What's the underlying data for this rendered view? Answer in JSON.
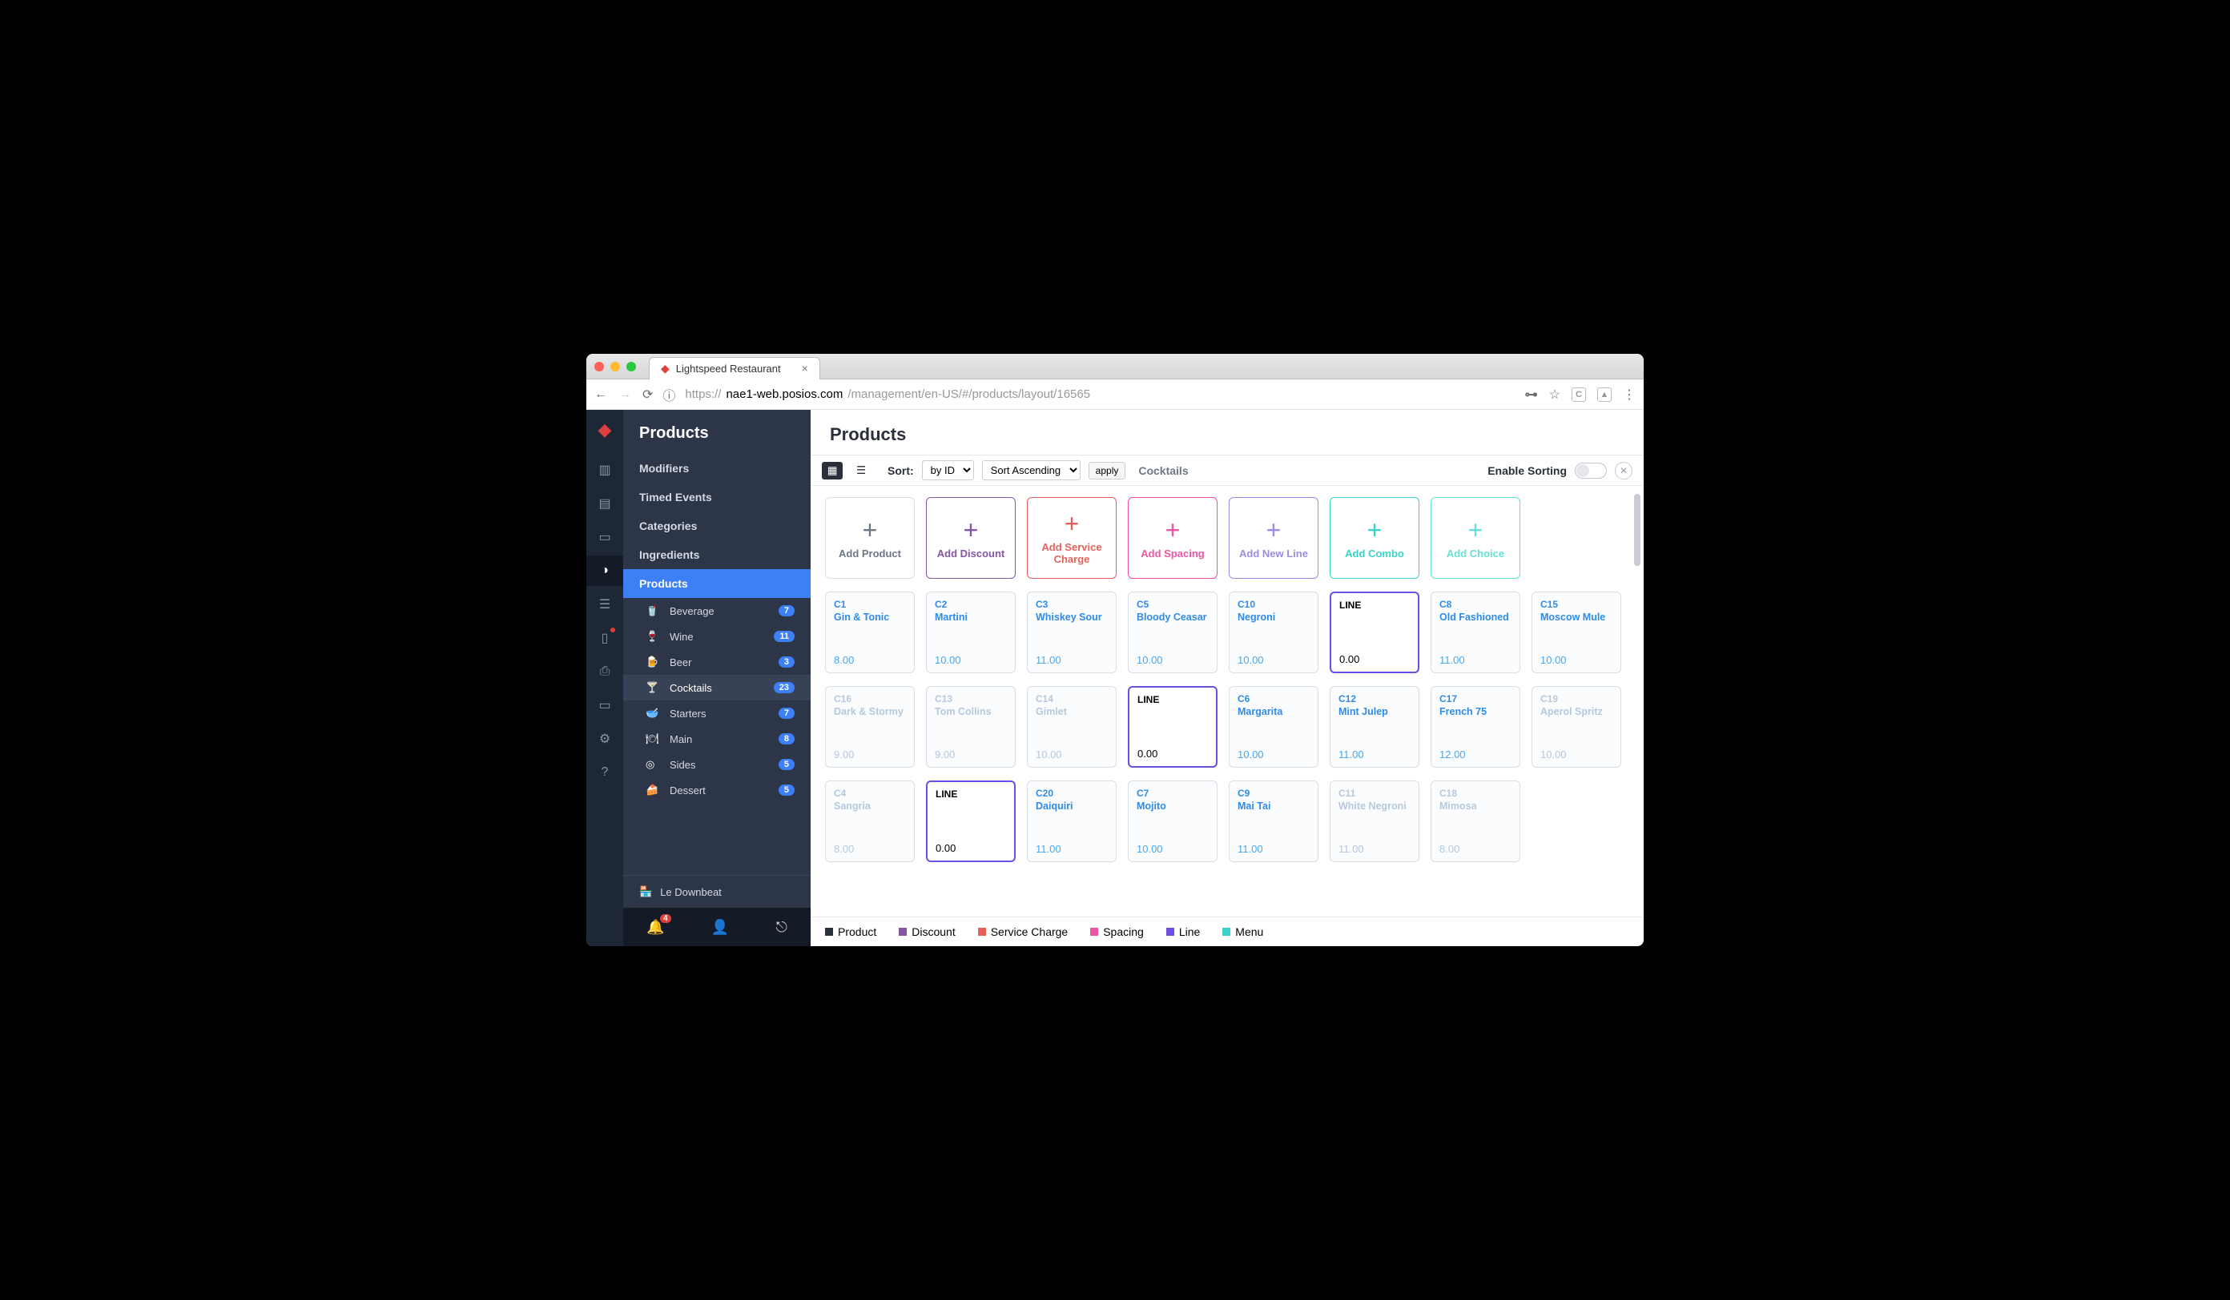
{
  "browser": {
    "tab_title": "Lightspeed Restaurant",
    "url_proto": "https://",
    "url_host": "nae1-web.posios.com",
    "url_path": "/management/en-US/#/products/layout/16565"
  },
  "sidebar": {
    "title": "Products",
    "items": [
      {
        "label": "Modifiers"
      },
      {
        "label": "Timed Events"
      },
      {
        "label": "Categories"
      },
      {
        "label": "Ingredients"
      },
      {
        "label": "Products"
      }
    ],
    "categories": [
      {
        "label": "Beverage",
        "count": "7",
        "icon": "🥤"
      },
      {
        "label": "Wine",
        "count": "11",
        "icon": "🍷"
      },
      {
        "label": "Beer",
        "count": "3",
        "icon": "🍺"
      },
      {
        "label": "Cocktails",
        "count": "23",
        "icon": "🍸"
      },
      {
        "label": "Starters",
        "count": "7",
        "icon": "🥣"
      },
      {
        "label": "Main",
        "count": "8",
        "icon": "🍽"
      },
      {
        "label": "Sides",
        "count": "5",
        "icon": "◎"
      },
      {
        "label": "Dessert",
        "count": "5",
        "icon": "🍰"
      }
    ],
    "store_name": "Le Downbeat",
    "bell_count": "4"
  },
  "main": {
    "title": "Products",
    "sort_label": "Sort:",
    "sort_by": "by ID",
    "sort_dir": "Sort Ascending",
    "apply": "apply",
    "breadcrumb": "Cocktails",
    "enable_sorting": "Enable Sorting"
  },
  "add_tiles": [
    {
      "label": "Add Product",
      "cls": "add-default"
    },
    {
      "label": "Add Discount",
      "cls": "c-discount"
    },
    {
      "label": "Add Service Charge",
      "cls": "c-service"
    },
    {
      "label": "Add Spacing",
      "cls": "c-spacing"
    },
    {
      "label": "Add New Line",
      "cls": "c-newline"
    },
    {
      "label": "Add Combo",
      "cls": "c-combo"
    },
    {
      "label": "Add Choice",
      "cls": "c-choice"
    }
  ],
  "rows": [
    [
      {
        "type": "product",
        "code": "C1",
        "name": "Gin & Tonic",
        "price": "8.00"
      },
      {
        "type": "product",
        "code": "C2",
        "name": "Martini",
        "price": "10.00"
      },
      {
        "type": "product",
        "code": "C3",
        "name": "Whiskey Sour",
        "price": "11.00"
      },
      {
        "type": "product",
        "code": "C5",
        "name": "Bloody Ceasar",
        "price": "10.00"
      },
      {
        "type": "product",
        "code": "C10",
        "name": "Negroni",
        "price": "10.00"
      },
      {
        "type": "line",
        "code": "LINE",
        "name": "",
        "price": "0.00"
      },
      {
        "type": "product",
        "code": "C8",
        "name": "Old Fashioned",
        "price": "11.00"
      },
      {
        "type": "product",
        "code": "C15",
        "name": "Moscow Mule",
        "price": "10.00"
      }
    ],
    [
      {
        "type": "muted",
        "code": "C16",
        "name": "Dark & Stormy",
        "price": "9.00"
      },
      {
        "type": "muted",
        "code": "C13",
        "name": "Tom Collins",
        "price": "9.00"
      },
      {
        "type": "muted",
        "code": "C14",
        "name": "Gimlet",
        "price": "10.00"
      },
      {
        "type": "line",
        "code": "LINE",
        "name": "",
        "price": "0.00"
      },
      {
        "type": "product",
        "code": "C6",
        "name": "Margarita",
        "price": "10.00"
      },
      {
        "type": "product",
        "code": "C12",
        "name": "Mint Julep",
        "price": "11.00"
      },
      {
        "type": "product",
        "code": "C17",
        "name": "French 75",
        "price": "12.00"
      },
      {
        "type": "muted",
        "code": "C19",
        "name": "Aperol Spritz",
        "price": "10.00"
      }
    ],
    [
      {
        "type": "muted",
        "code": "C4",
        "name": "Sangria",
        "price": "8.00"
      },
      {
        "type": "line",
        "code": "LINE",
        "name": "",
        "price": "0.00"
      },
      {
        "type": "product",
        "code": "C20",
        "name": "Daiquiri",
        "price": "11.00"
      },
      {
        "type": "product",
        "code": "C7",
        "name": "Mojito",
        "price": "10.00"
      },
      {
        "type": "product",
        "code": "C9",
        "name": "Mai Tai",
        "price": "11.00"
      },
      {
        "type": "muted",
        "code": "C11",
        "name": "White Negroni",
        "price": "11.00"
      },
      {
        "type": "muted",
        "code": "C18",
        "name": "Mimosa",
        "price": "8.00"
      }
    ]
  ],
  "legend": [
    {
      "label": "Product",
      "sw": "sw-product"
    },
    {
      "label": "Discount",
      "sw": "sw-discount"
    },
    {
      "label": "Service Charge",
      "sw": "sw-service"
    },
    {
      "label": "Spacing",
      "sw": "sw-spacing"
    },
    {
      "label": "Line",
      "sw": "sw-line"
    },
    {
      "label": "Menu",
      "sw": "sw-menu"
    }
  ]
}
